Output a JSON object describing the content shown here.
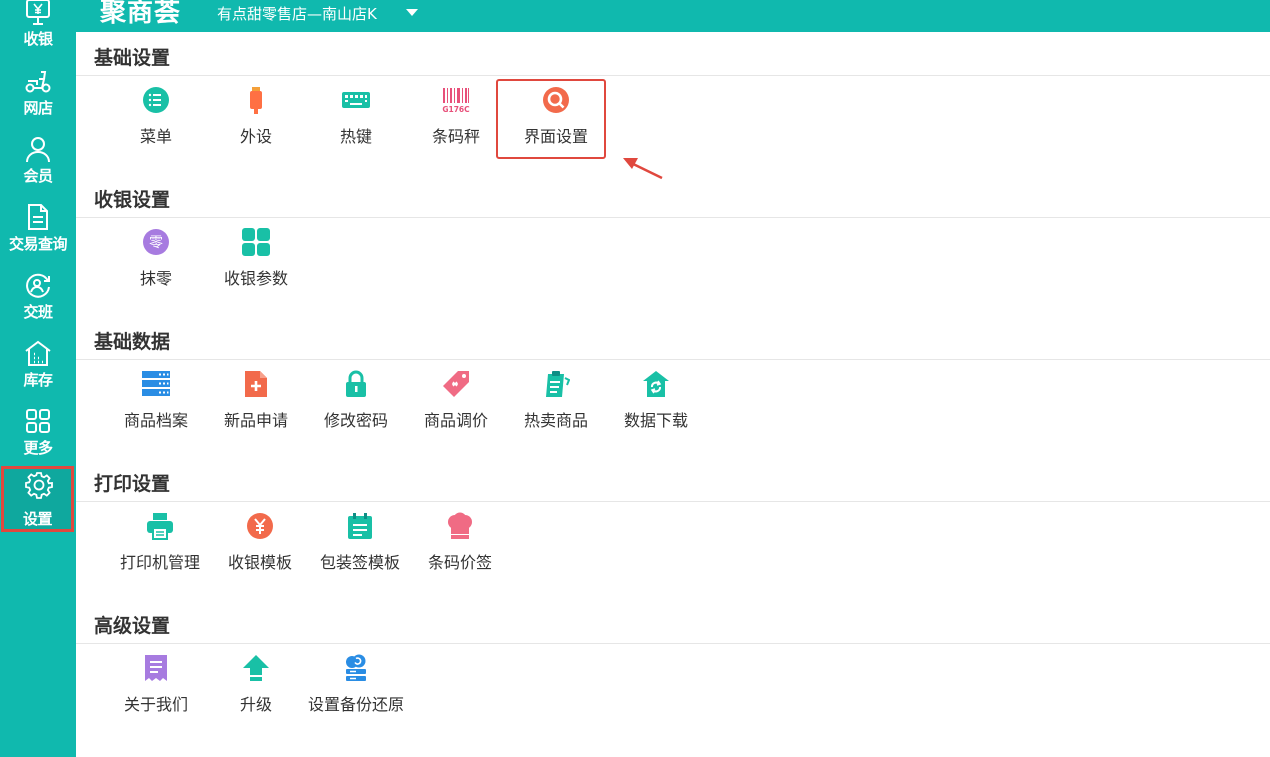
{
  "app": {
    "logo": "聚商荟",
    "store_name": "有点甜零售店—南山店K",
    "accent": "#10b9ae",
    "highlight": "#e0483e"
  },
  "sidebar": {
    "items": [
      {
        "label": "收银",
        "icon": "yen-register-icon"
      },
      {
        "label": "网店",
        "icon": "scooter-icon"
      },
      {
        "label": "会员",
        "icon": "user-icon"
      },
      {
        "label": "交易查询",
        "icon": "document-icon"
      },
      {
        "label": "交班",
        "icon": "shift-change-icon"
      },
      {
        "label": "库存",
        "icon": "warehouse-icon"
      },
      {
        "label": "更多",
        "icon": "grid-icon"
      },
      {
        "label": "设置",
        "icon": "gear-icon",
        "active": true
      }
    ]
  },
  "sections": [
    {
      "title": "基础设置",
      "items": [
        {
          "label": "菜单",
          "icon": "menu-list-icon",
          "color": "#19c0a6"
        },
        {
          "label": "外设",
          "icon": "peripheral-icon",
          "color": "#ff7043"
        },
        {
          "label": "热键",
          "icon": "keyboard-icon",
          "color": "#19c0a6"
        },
        {
          "label": "条码秤",
          "icon": "barcode-icon",
          "color": "#e8507a",
          "icon_text": "G176C"
        },
        {
          "label": "界面设置",
          "icon": "search-lens-icon",
          "color": "#f26a4b"
        }
      ]
    },
    {
      "title": "收银设置",
      "items": [
        {
          "label": "抹零",
          "icon": "zero-coin-icon",
          "color": "#a77be0",
          "icon_text": "零"
        },
        {
          "label": "收银参数",
          "icon": "four-squares-icon",
          "color": "#19c0a6"
        }
      ]
    },
    {
      "title": "基础数据",
      "items": [
        {
          "label": "商品档案",
          "icon": "server-icon",
          "color": "#2a8de4"
        },
        {
          "label": "新品申请",
          "icon": "new-file-icon",
          "color": "#f26a4b"
        },
        {
          "label": "修改密码",
          "icon": "lock-icon",
          "color": "#19c0a6"
        },
        {
          "label": "商品调价",
          "icon": "price-tag-icon",
          "color": "#f06b84"
        },
        {
          "label": "热卖商品",
          "icon": "hot-clipboard-icon",
          "color": "#19c0a6"
        },
        {
          "label": "数据下载",
          "icon": "home-sync-icon",
          "color": "#19c0a6"
        }
      ]
    },
    {
      "title": "打印设置",
      "items": [
        {
          "label": "打印机管理",
          "icon": "printer-icon",
          "color": "#19c0a6"
        },
        {
          "label": "收银模板",
          "icon": "yen-coin-icon",
          "color": "#f26a4b"
        },
        {
          "label": "包装签模板",
          "icon": "calendar-icon",
          "color": "#19c0a6"
        },
        {
          "label": "条码价签",
          "icon": "chef-hat-icon",
          "color": "#f06b84"
        }
      ]
    },
    {
      "title": "高级设置",
      "items": [
        {
          "label": "关于我们",
          "icon": "receipt-icon",
          "color": "#a77be0"
        },
        {
          "label": "升级",
          "icon": "upload-arrow-icon",
          "color": "#19c0a6"
        },
        {
          "label": "设置备份还原",
          "icon": "cloud-backup-icon",
          "color": "#2a8de4"
        }
      ]
    }
  ]
}
